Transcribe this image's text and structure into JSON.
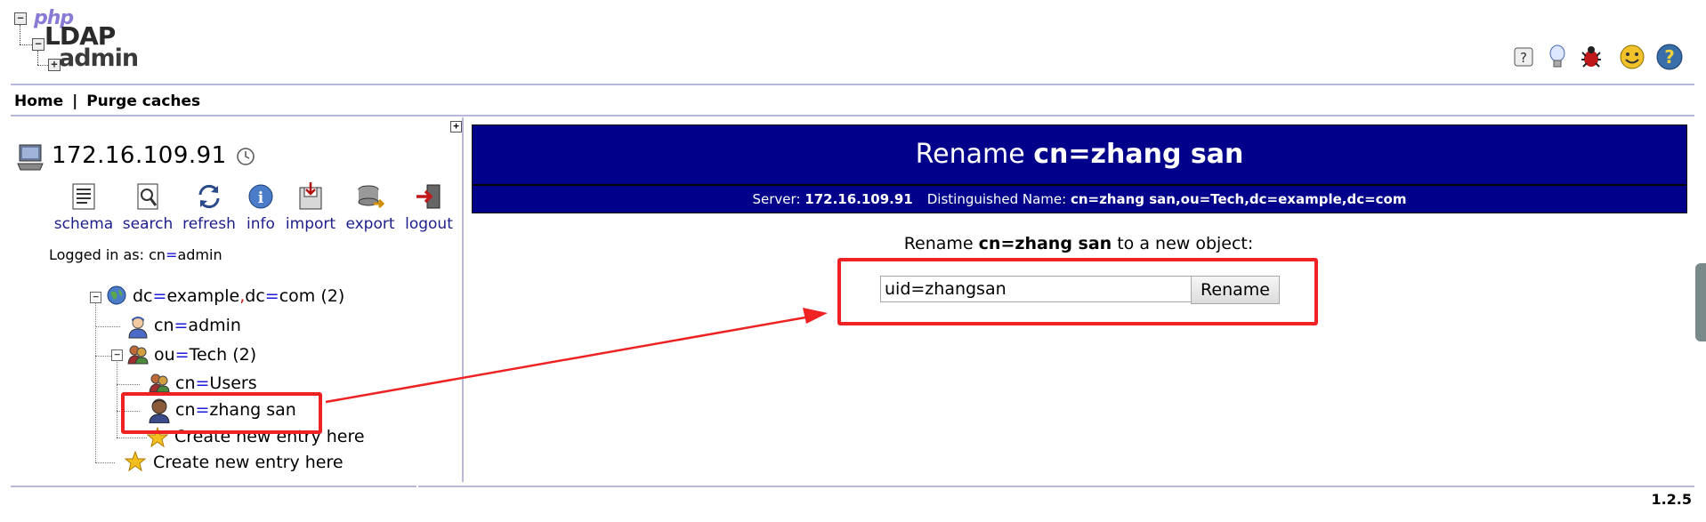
{
  "logo": {
    "php": "php",
    "ldap": "LDAP",
    "admin": "admin"
  },
  "top_icons": [
    "help-icon",
    "lightbulb-icon",
    "bug-icon",
    "smiley-icon",
    "question-icon"
  ],
  "topnav": {
    "home": "Home",
    "sep": "|",
    "purge": "Purge caches"
  },
  "server": {
    "name": "172.16.109.91"
  },
  "tools": [
    {
      "label": "schema",
      "icon": "schema-icon"
    },
    {
      "label": "search",
      "icon": "search-icon"
    },
    {
      "label": "refresh",
      "icon": "refresh-icon"
    },
    {
      "label": "info",
      "icon": "info-icon"
    },
    {
      "label": "import",
      "icon": "import-icon"
    },
    {
      "label": "export",
      "icon": "export-icon"
    },
    {
      "label": "logout",
      "icon": "logout-icon"
    }
  ],
  "logged_in": {
    "prefix": "Logged in as: cn",
    "eq": "=",
    "user": "admin"
  },
  "tree": {
    "root": {
      "a": "dc",
      "b": "example",
      "c": "dc",
      "d": "com",
      "count": "(2)"
    },
    "admin": {
      "attr": "cn",
      "val": "admin"
    },
    "tech": {
      "attr": "ou",
      "val": "Tech",
      "count": "(2)"
    },
    "users": {
      "attr": "cn",
      "val": "Users"
    },
    "zhang": {
      "attr": "cn",
      "val": "zhang san"
    },
    "create_inner": "Create new entry here",
    "create_outer": "Create new entry here"
  },
  "main": {
    "title_prefix": "Rename ",
    "title_dn": "cn=zhang san",
    "server_label": "Server: ",
    "server_value": "172.16.109.91",
    "dn_label": "Distinguished Name: ",
    "dn_value": "cn=zhang san,ou=Tech,dc=example,dc=com",
    "prompt_prefix": "Rename ",
    "prompt_dn": "cn=zhang san",
    "prompt_suffix": " to a new object:",
    "input_value": "uid=zhangsan",
    "button_label": "Rename"
  },
  "footer": {
    "version": "1.2.5"
  },
  "colors": {
    "header_bg": "#00008b",
    "annotation": "#ee2222",
    "divider": "#b8b8dc"
  }
}
